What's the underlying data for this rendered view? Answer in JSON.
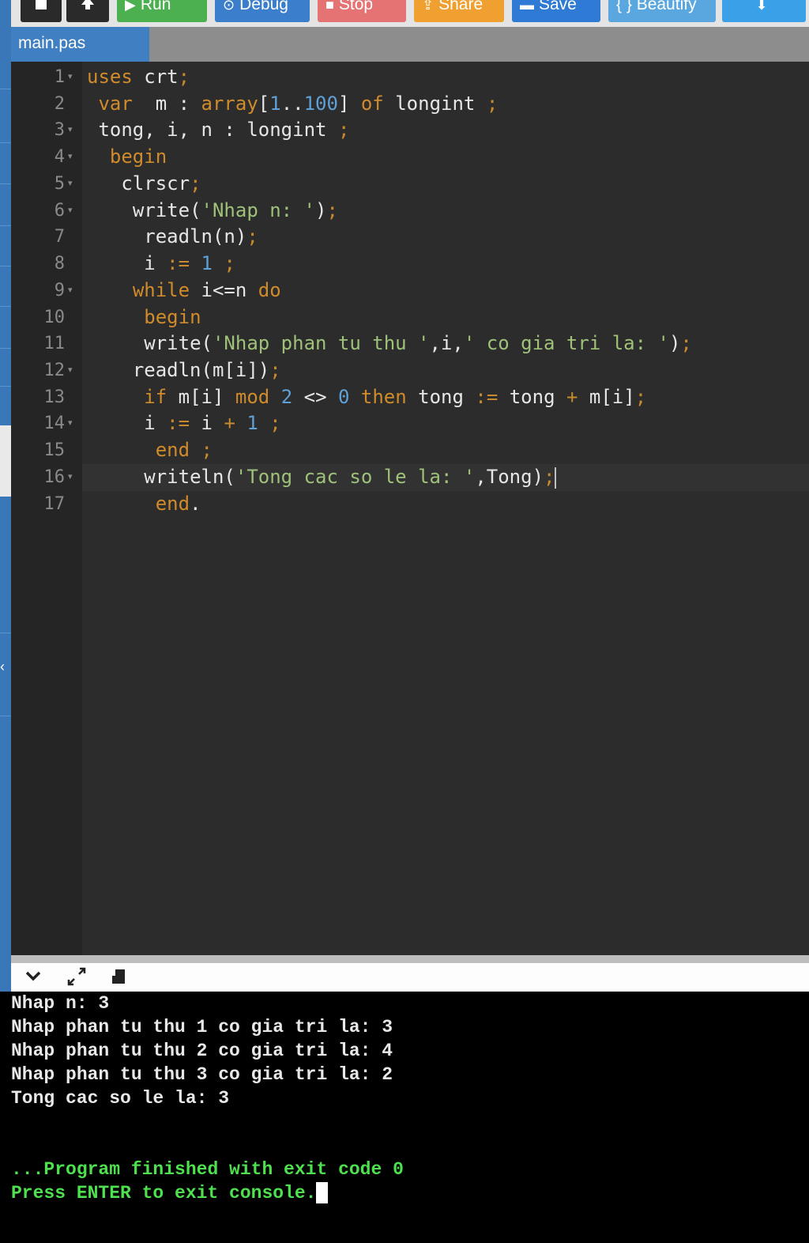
{
  "toolbar": {
    "buttons": [
      {
        "id": "new",
        "label": "",
        "icon": "file-icon",
        "color": "#2a2a2a"
      },
      {
        "id": "upload",
        "label": "",
        "icon": "upload-icon",
        "color": "#2a2a2a"
      },
      {
        "id": "run",
        "label": "Run",
        "icon": "play-icon",
        "color": "#4caf50"
      },
      {
        "id": "debug",
        "label": "Debug",
        "icon": "debug-icon",
        "color": "#3b7ecb"
      },
      {
        "id": "stop",
        "label": "Stop",
        "icon": "stop-icon",
        "color": "#e57373"
      },
      {
        "id": "share",
        "label": "Share",
        "icon": "share-icon",
        "color": "#f0a030"
      },
      {
        "id": "save",
        "label": "Save",
        "icon": "save-icon",
        "color": "#2f7ad4"
      },
      {
        "id": "beautify",
        "label": "{ } Beautify",
        "icon": "",
        "color": "#5aa7e0"
      },
      {
        "id": "download",
        "label": "",
        "icon": "download-icon",
        "color": "#3aa0e8"
      }
    ]
  },
  "file_tab": {
    "name": "main.pas",
    "color": "#3f7fc2"
  },
  "editor": {
    "line_numbers": [
      "1",
      "2",
      "3",
      "4",
      "5",
      "6",
      "7",
      "8",
      "9",
      "10",
      "11",
      "12",
      "13",
      "14",
      "15",
      "16",
      "17"
    ],
    "lines": [
      "uses crt;",
      " var  m : array[1..100] of longint ;",
      " tong, i, n : longint ;",
      "  begin",
      "   clrscr;",
      "    write('Nhap n: ');",
      "     readln(n);",
      "     i := 1 ;",
      "    while i<=n do",
      "     begin",
      "     write('Nhap phan tu thu ',i,' co gia tri la: ');",
      "    readln(m[i]);",
      "     if m[i] mod 2 <> 0 then tong := tong + m[i];",
      "     i := i + 1 ;",
      "      end ;",
      "     writeln('Tong cac so le la: ',Tong);",
      "      end."
    ],
    "active_line": "16",
    "colors": {
      "keyword": "#d08b2b",
      "number": "#5fa0d6",
      "string": "#9fc179",
      "text": "#e6e6e6",
      "background": "#2c2c2c"
    }
  },
  "console_toolbar": {
    "icons": [
      "chevron-down-icon",
      "expand-icon",
      "clear-console-icon"
    ]
  },
  "console": {
    "lines": [
      "Nhap n: 3",
      "Nhap phan tu thu 1 co gia tri la: 3",
      "Nhap phan tu thu 2 co gia tri la: 4",
      "Nhap phan tu thu 3 co gia tri la: 2",
      "Tong cac so le la: 3"
    ],
    "finished": "...Program finished with exit code 0",
    "press_enter": "Press ENTER to exit console.",
    "colors": {
      "output": "#e8e8e8",
      "status": "#4ee04e"
    }
  }
}
